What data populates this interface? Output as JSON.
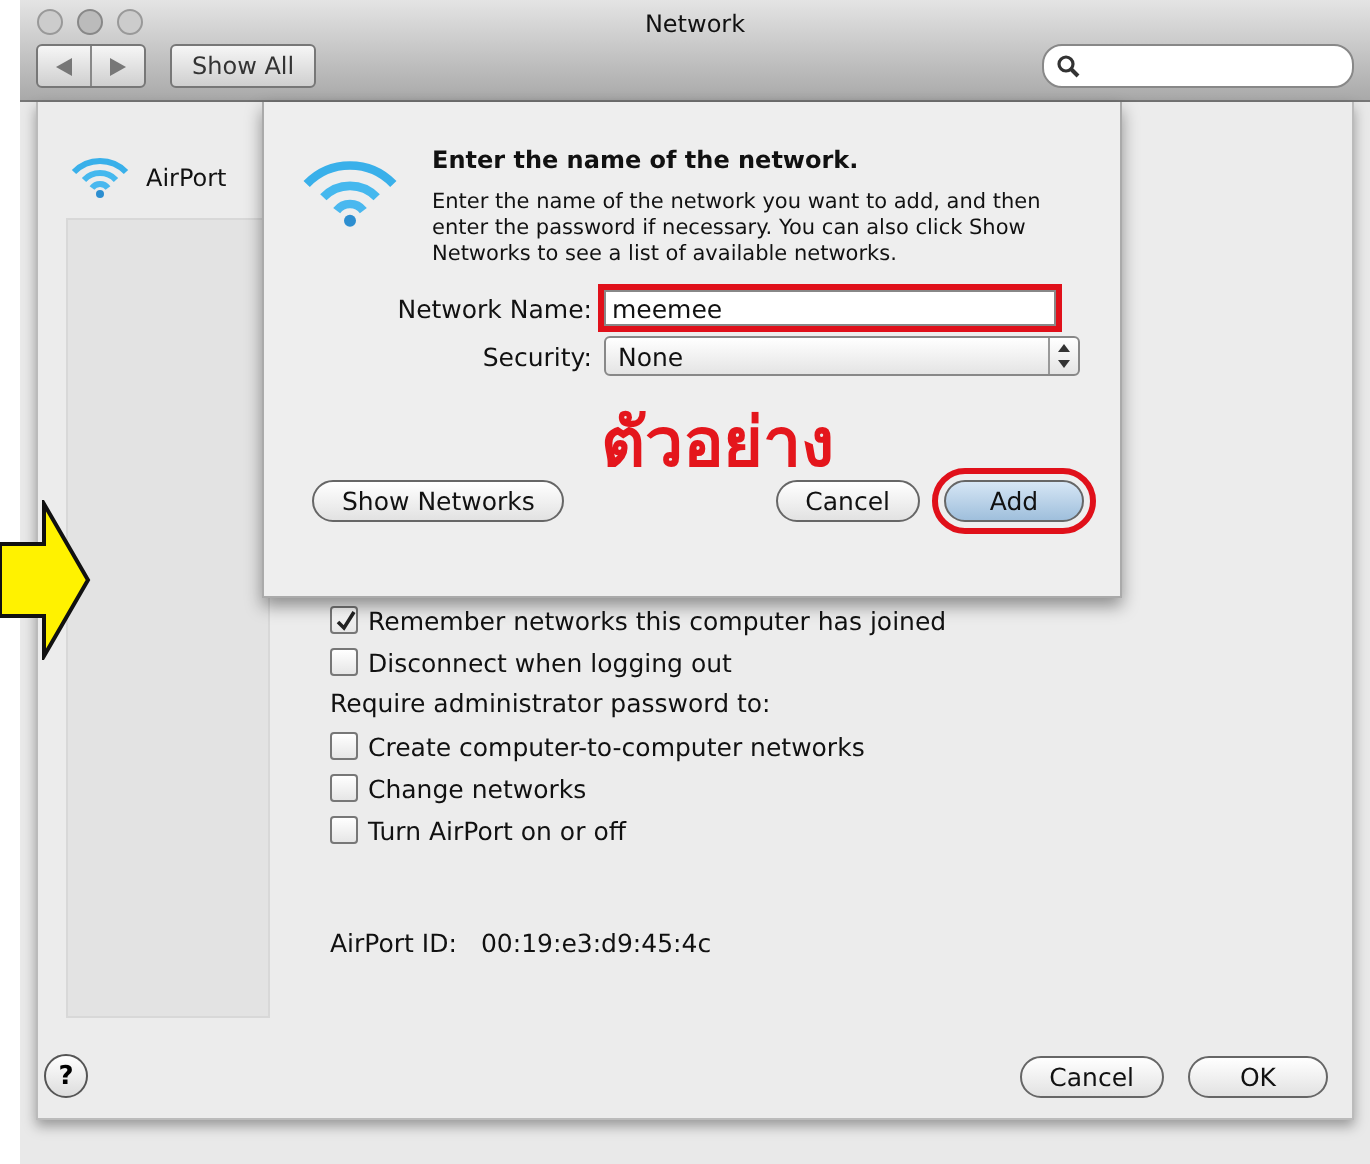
{
  "window": {
    "title": "Network",
    "show_all": "Show All"
  },
  "service": {
    "label": "AirPort"
  },
  "sheet": {
    "options": [
      {
        "kind": "checkbox",
        "label": "Remember networks this computer has joined",
        "checked": true
      },
      {
        "kind": "checkbox",
        "label": "Disconnect when logging out",
        "checked": false
      },
      {
        "kind": "heading",
        "label": "Require administrator password to:"
      },
      {
        "kind": "checkbox",
        "label": "Create computer-to-computer networks",
        "checked": false
      },
      {
        "kind": "checkbox",
        "label": "Change networks",
        "checked": false
      },
      {
        "kind": "checkbox",
        "label": "Turn AirPort on or off",
        "checked": false
      }
    ],
    "airport_id": {
      "label": "AirPort ID:",
      "value": "00:19:e3:d9:45:4c"
    },
    "help": "?",
    "buttons": [
      "Cancel",
      "OK"
    ]
  },
  "dialog": {
    "title": "Enter the name of the network.",
    "message": "Enter the name of the network you want to add, and then enter the password if necessary. You can also click Show Networks to see a list of available networks.",
    "fields": [
      {
        "kind": "text",
        "label": "Network Name:",
        "value": "meemee",
        "highlighted": true
      },
      {
        "kind": "popup",
        "label": "Security:",
        "value": "None",
        "highlighted": false
      }
    ],
    "buttons": [
      {
        "label": "Show Networks",
        "highlighted": false
      },
      {
        "label": "Cancel",
        "highlighted": false
      },
      {
        "label": "Add",
        "highlighted": true
      }
    ]
  },
  "annotation": {
    "text": "ตัวอย่าง"
  }
}
